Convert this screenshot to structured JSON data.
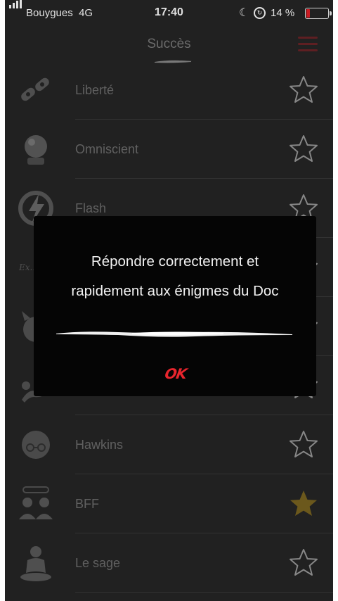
{
  "status_bar": {
    "carrier": "Bouygues",
    "network": "4G",
    "time": "17:40",
    "battery_percent": "14 %",
    "icons": [
      "signal-bars-icon",
      "moon-icon",
      "orientation-lock-icon",
      "battery-icon"
    ]
  },
  "header": {
    "title": "Succès",
    "menu_icon": "hamburger-menu-icon"
  },
  "achievements": [
    {
      "label": "Liberté",
      "icon": "broken-chain-icon",
      "unlocked": false
    },
    {
      "label": "Omniscient",
      "icon": "crystal-ball-icon",
      "unlocked": false
    },
    {
      "label": "Flash",
      "icon": "lightning-icon",
      "unlocked": false
    },
    {
      "label": "",
      "icon": "script-text-icon",
      "unlocked": false
    },
    {
      "label": "",
      "icon": "devil-head-icon",
      "unlocked": false
    },
    {
      "label": "",
      "icon": "crawling-figure-icon",
      "unlocked": false
    },
    {
      "label": "Hawkins",
      "icon": "hawking-face-icon",
      "unlocked": false
    },
    {
      "label": "BFF",
      "icon": "two-friends-icon",
      "unlocked": true
    },
    {
      "label": "Le sage",
      "icon": "meditating-person-icon",
      "unlocked": false
    }
  ],
  "colors": {
    "background": "#262626",
    "label": "#6e6e6e",
    "star_outline": "#9a9a9a",
    "star_unlocked": "#7a6520",
    "accent_red": "#e8252d",
    "dialog_bg": "#050505"
  },
  "dialog": {
    "message_line1": "Répondre correctement et",
    "message_line2": "rapidement aux énigmes du Doc",
    "ok_label": "OK"
  }
}
